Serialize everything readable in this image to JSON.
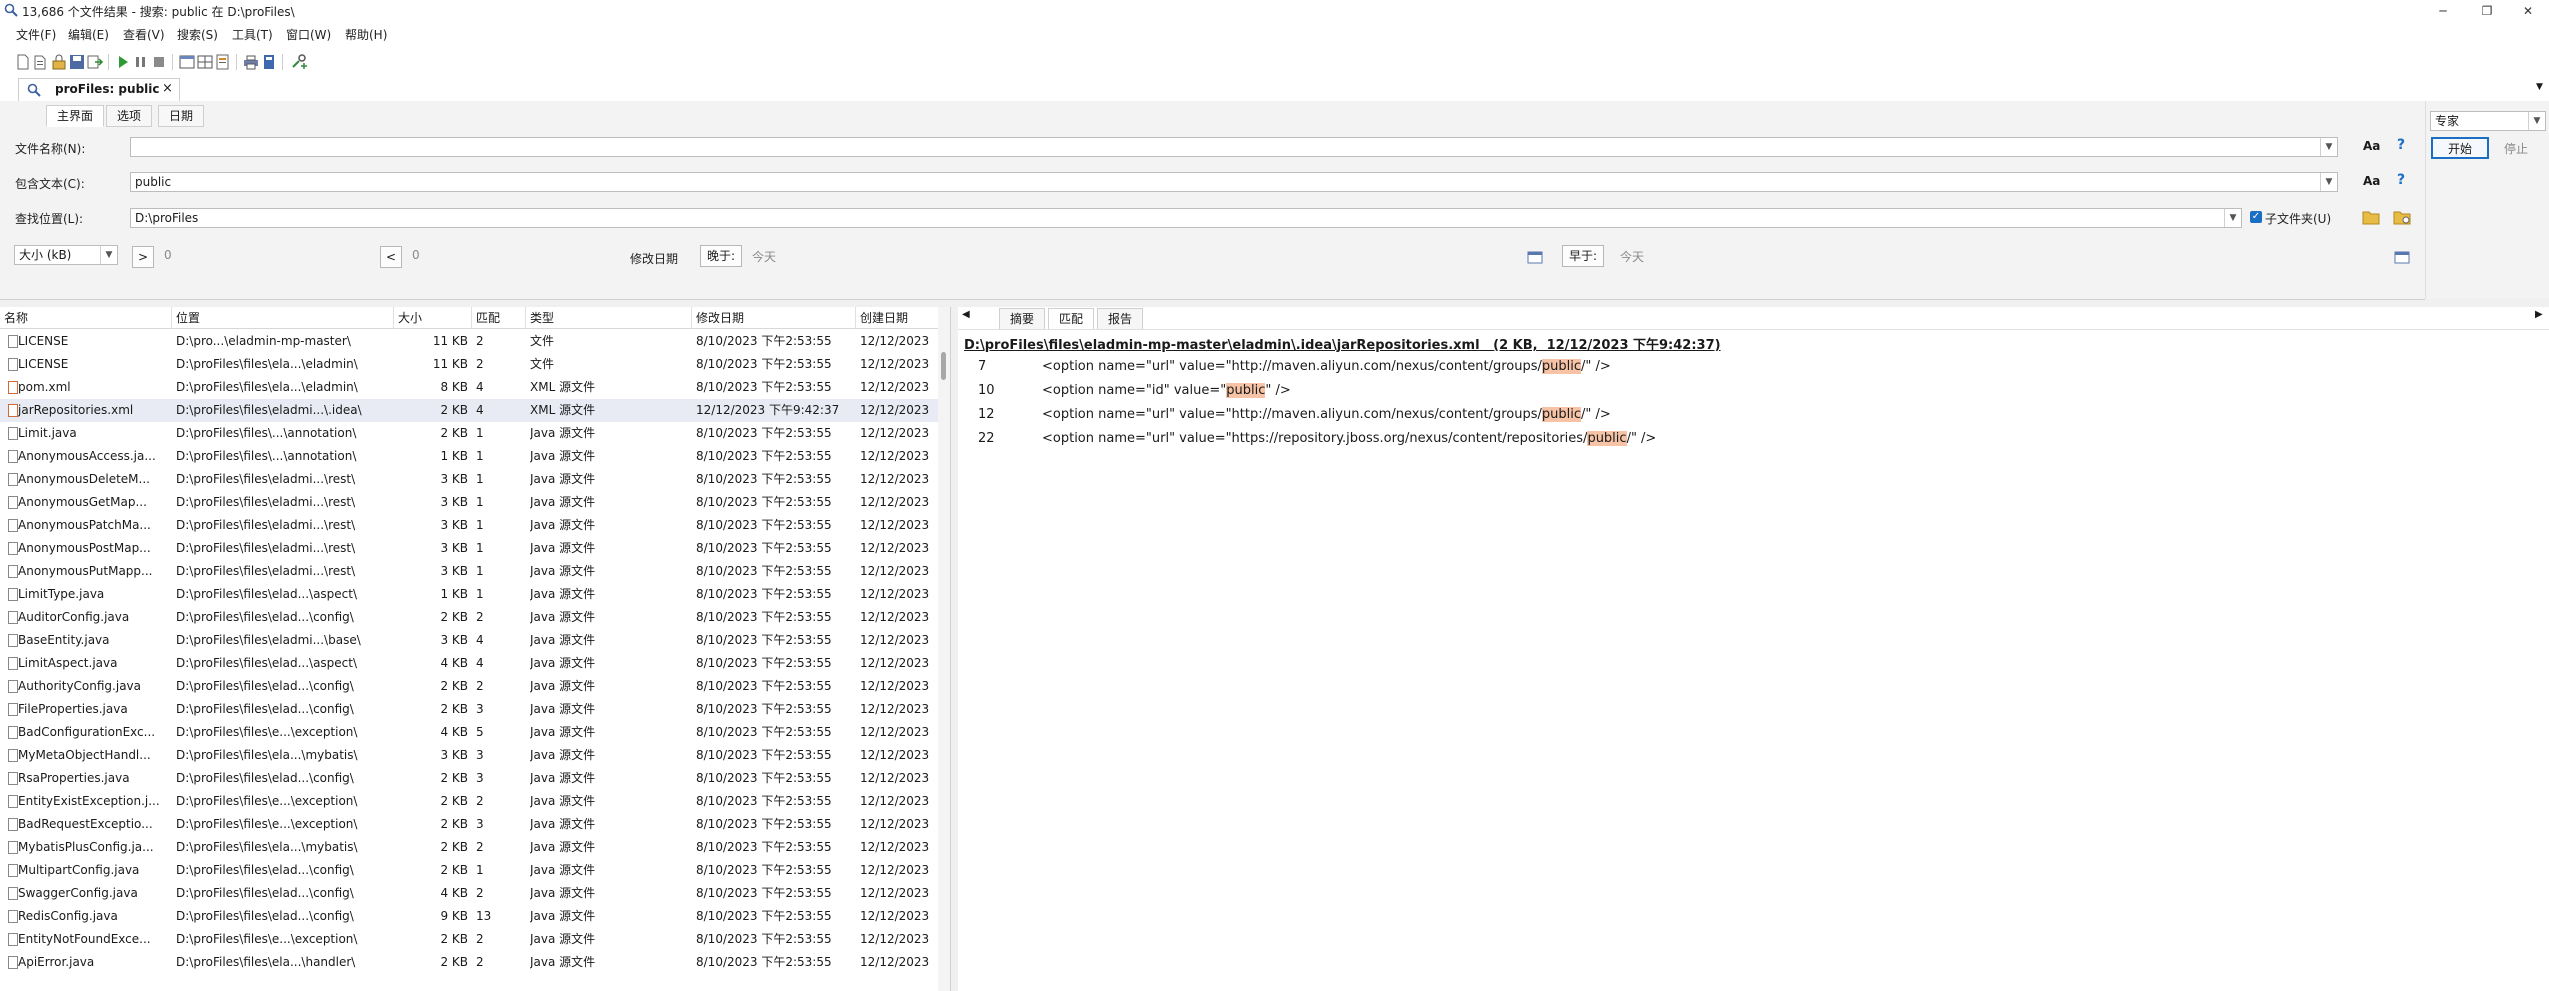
{
  "window": {
    "title": "13,686 个文件结果 - 搜索: public 在 D:\\proFiles\\"
  },
  "menubar": [
    "文件(F)",
    "编辑(E)",
    "查看(V)",
    "搜索(S)",
    "工具(T)",
    "窗口(W)",
    "帮助(H)"
  ],
  "doc_tab": {
    "label": "proFiles: public",
    "close": "×"
  },
  "subtabs": [
    "主界面",
    "选项",
    "日期"
  ],
  "form": {
    "filename_label": "文件名称(N):",
    "filename_value": "",
    "contains_label": "包含文本(C):",
    "contains_value": "public",
    "location_label": "查找位置(L):",
    "location_value": "D:\\proFiles",
    "subfolders_label": "子文件夹(U)",
    "size_select": "大小 (kB)",
    "gt": ">",
    "gt_value": "0",
    "lt": "<",
    "lt_value": "0",
    "modified_label": "修改日期",
    "later_btn": "晚于:",
    "later_value": "今天",
    "earlier_btn": "早于:",
    "earlier_value": "今天"
  },
  "right_panel": {
    "mode": "专家",
    "start": "开始",
    "stop": "停止"
  },
  "columns": [
    "名称",
    "位置",
    "大小",
    "匹配",
    "类型",
    "修改日期",
    "创建日期"
  ],
  "rows": [
    {
      "name": "LICENSE",
      "loc": "D:\\pro...\\eladmin-mp-master\\",
      "size": "11 KB",
      "match": "2",
      "type": "文件",
      "mod": "8/10/2023 下午2:53:55",
      "created": "12/12/2023"
    },
    {
      "name": "LICENSE",
      "loc": "D:\\proFiles\\files\\ela...\\eladmin\\",
      "size": "11 KB",
      "match": "2",
      "type": "文件",
      "mod": "8/10/2023 下午2:53:55",
      "created": "12/12/2023"
    },
    {
      "name": "pom.xml",
      "loc": "D:\\proFiles\\files\\ela...\\eladmin\\",
      "size": "8 KB",
      "match": "4",
      "type": "XML 源文件",
      "mod": "8/10/2023 下午2:53:55",
      "created": "12/12/2023",
      "xml": true
    },
    {
      "name": "jarRepositories.xml",
      "loc": "D:\\proFiles\\files\\eladmi...\\.idea\\",
      "size": "2 KB",
      "match": "4",
      "type": "XML 源文件",
      "mod": "12/12/2023 下午9:42:37",
      "created": "12/12/2023",
      "xml": true,
      "sel": true
    },
    {
      "name": "Limit.java",
      "loc": "D:\\proFiles\\files\\...\\annotation\\",
      "size": "2 KB",
      "match": "1",
      "type": "Java 源文件",
      "mod": "8/10/2023 下午2:53:55",
      "created": "12/12/2023"
    },
    {
      "name": "AnonymousAccess.ja...",
      "loc": "D:\\proFiles\\files\\...\\annotation\\",
      "size": "1 KB",
      "match": "1",
      "type": "Java 源文件",
      "mod": "8/10/2023 下午2:53:55",
      "created": "12/12/2023"
    },
    {
      "name": "AnonymousDeleteM...",
      "loc": "D:\\proFiles\\files\\eladmi...\\rest\\",
      "size": "3 KB",
      "match": "1",
      "type": "Java 源文件",
      "mod": "8/10/2023 下午2:53:55",
      "created": "12/12/2023"
    },
    {
      "name": "AnonymousGetMap...",
      "loc": "D:\\proFiles\\files\\eladmi...\\rest\\",
      "size": "3 KB",
      "match": "1",
      "type": "Java 源文件",
      "mod": "8/10/2023 下午2:53:55",
      "created": "12/12/2023"
    },
    {
      "name": "AnonymousPatchMa...",
      "loc": "D:\\proFiles\\files\\eladmi...\\rest\\",
      "size": "3 KB",
      "match": "1",
      "type": "Java 源文件",
      "mod": "8/10/2023 下午2:53:55",
      "created": "12/12/2023"
    },
    {
      "name": "AnonymousPostMap...",
      "loc": "D:\\proFiles\\files\\eladmi...\\rest\\",
      "size": "3 KB",
      "match": "1",
      "type": "Java 源文件",
      "mod": "8/10/2023 下午2:53:55",
      "created": "12/12/2023"
    },
    {
      "name": "AnonymousPutMapp...",
      "loc": "D:\\proFiles\\files\\eladmi...\\rest\\",
      "size": "3 KB",
      "match": "1",
      "type": "Java 源文件",
      "mod": "8/10/2023 下午2:53:55",
      "created": "12/12/2023"
    },
    {
      "name": "LimitType.java",
      "loc": "D:\\proFiles\\files\\elad...\\aspect\\",
      "size": "1 KB",
      "match": "1",
      "type": "Java 源文件",
      "mod": "8/10/2023 下午2:53:55",
      "created": "12/12/2023"
    },
    {
      "name": "AuditorConfig.java",
      "loc": "D:\\proFiles\\files\\elad...\\config\\",
      "size": "2 KB",
      "match": "2",
      "type": "Java 源文件",
      "mod": "8/10/2023 下午2:53:55",
      "created": "12/12/2023"
    },
    {
      "name": "BaseEntity.java",
      "loc": "D:\\proFiles\\files\\eladmi...\\base\\",
      "size": "3 KB",
      "match": "4",
      "type": "Java 源文件",
      "mod": "8/10/2023 下午2:53:55",
      "created": "12/12/2023"
    },
    {
      "name": "LimitAspect.java",
      "loc": "D:\\proFiles\\files\\elad...\\aspect\\",
      "size": "4 KB",
      "match": "4",
      "type": "Java 源文件",
      "mod": "8/10/2023 下午2:53:55",
      "created": "12/12/2023"
    },
    {
      "name": "AuthorityConfig.java",
      "loc": "D:\\proFiles\\files\\elad...\\config\\",
      "size": "2 KB",
      "match": "2",
      "type": "Java 源文件",
      "mod": "8/10/2023 下午2:53:55",
      "created": "12/12/2023"
    },
    {
      "name": "FileProperties.java",
      "loc": "D:\\proFiles\\files\\elad...\\config\\",
      "size": "2 KB",
      "match": "3",
      "type": "Java 源文件",
      "mod": "8/10/2023 下午2:53:55",
      "created": "12/12/2023"
    },
    {
      "name": "BadConfigurationExc...",
      "loc": "D:\\proFiles\\files\\e...\\exception\\",
      "size": "4 KB",
      "match": "5",
      "type": "Java 源文件",
      "mod": "8/10/2023 下午2:53:55",
      "created": "12/12/2023"
    },
    {
      "name": "MyMetaObjectHandl...",
      "loc": "D:\\proFiles\\files\\ela...\\mybatis\\",
      "size": "3 KB",
      "match": "3",
      "type": "Java 源文件",
      "mod": "8/10/2023 下午2:53:55",
      "created": "12/12/2023"
    },
    {
      "name": "RsaProperties.java",
      "loc": "D:\\proFiles\\files\\elad...\\config\\",
      "size": "2 KB",
      "match": "3",
      "type": "Java 源文件",
      "mod": "8/10/2023 下午2:53:55",
      "created": "12/12/2023"
    },
    {
      "name": "EntityExistException.j...",
      "loc": "D:\\proFiles\\files\\e...\\exception\\",
      "size": "2 KB",
      "match": "2",
      "type": "Java 源文件",
      "mod": "8/10/2023 下午2:53:55",
      "created": "12/12/2023"
    },
    {
      "name": "BadRequestExceptio...",
      "loc": "D:\\proFiles\\files\\e...\\exception\\",
      "size": "2 KB",
      "match": "3",
      "type": "Java 源文件",
      "mod": "8/10/2023 下午2:53:55",
      "created": "12/12/2023"
    },
    {
      "name": "MybatisPlusConfig.ja...",
      "loc": "D:\\proFiles\\files\\ela...\\mybatis\\",
      "size": "2 KB",
      "match": "2",
      "type": "Java 源文件",
      "mod": "8/10/2023 下午2:53:55",
      "created": "12/12/2023"
    },
    {
      "name": "MultipartConfig.java",
      "loc": "D:\\proFiles\\files\\elad...\\config\\",
      "size": "2 KB",
      "match": "1",
      "type": "Java 源文件",
      "mod": "8/10/2023 下午2:53:55",
      "created": "12/12/2023"
    },
    {
      "name": "SwaggerConfig.java",
      "loc": "D:\\proFiles\\files\\elad...\\config\\",
      "size": "4 KB",
      "match": "2",
      "type": "Java 源文件",
      "mod": "8/10/2023 下午2:53:55",
      "created": "12/12/2023"
    },
    {
      "name": "RedisConfig.java",
      "loc": "D:\\proFiles\\files\\elad...\\config\\",
      "size": "9 KB",
      "match": "13",
      "type": "Java 源文件",
      "mod": "8/10/2023 下午2:53:55",
      "created": "12/12/2023"
    },
    {
      "name": "EntityNotFoundExce...",
      "loc": "D:\\proFiles\\files\\e...\\exception\\",
      "size": "2 KB",
      "match": "2",
      "type": "Java 源文件",
      "mod": "8/10/2023 下午2:53:55",
      "created": "12/12/2023"
    },
    {
      "name": "ApiError.java",
      "loc": "D:\\proFiles\\files\\ela...\\handler\\",
      "size": "2 KB",
      "match": "2",
      "type": "Java 源文件",
      "mod": "8/10/2023 下午2:53:55",
      "created": "12/12/2023"
    }
  ],
  "preview": {
    "tabs": [
      "摘要",
      "匹配",
      "报告"
    ],
    "path": "D:\\proFiles\\files\\eladmin-mp-master\\eladmin\\.idea\\jarRepositories.xml",
    "meta": "(2 KB,  12/12/2023 下午9:42:37)",
    "lines": [
      {
        "no": "7",
        "pre": "<option name=\"url\" value=\"http://maven.aliyun.com/nexus/content/groups/",
        "hit": "public",
        "post": "/\" />"
      },
      {
        "no": "10",
        "pre": "<option name=\"id\" value=\"",
        "hit": "public",
        "post": "\" />"
      },
      {
        "no": "12",
        "pre": "<option name=\"url\" value=\"http://maven.aliyun.com/nexus/content/groups/",
        "hit": "public",
        "post": "/\" />"
      },
      {
        "no": "22",
        "pre": "<option name=\"url\" value=\"https://repository.jboss.org/nexus/content/repositories/",
        "hit": "public",
        "post": "/\" />"
      }
    ]
  },
  "colors": {
    "selected_row": "#e8ebf3",
    "highlight": "#f6c3a6",
    "accent": "#1a6fc4"
  }
}
